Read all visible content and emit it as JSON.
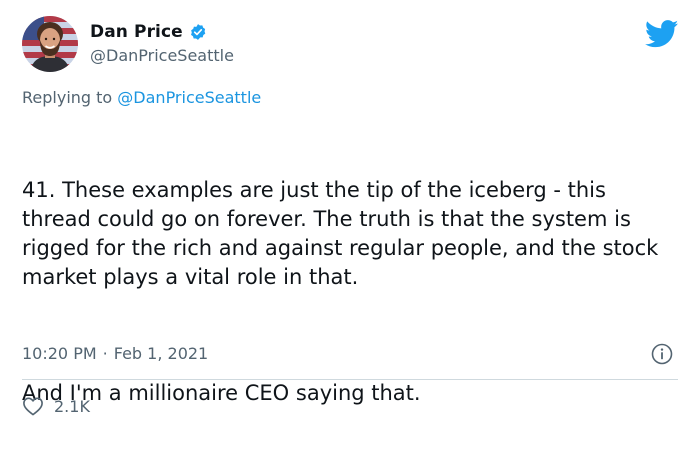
{
  "author": {
    "display_name": "Dan Price",
    "handle": "@DanPriceSeattle",
    "verified": true
  },
  "reply": {
    "prefix": "Replying to",
    "mention": "@DanPriceSeattle"
  },
  "tweet": {
    "paragraph_1": "41. These examples are just the tip of the iceberg - this thread could go on forever. The truth is that the system is rigged for the rich and against regular people, and the stock market plays a vital role in that.",
    "paragraph_2": "And I'm a millionaire CEO saying that."
  },
  "meta": {
    "time": "10:20 PM",
    "separator": "·",
    "date": "Feb 1, 2021"
  },
  "engagement": {
    "likes": "2.1K"
  },
  "icons": {
    "brand": "twitter-bird-icon",
    "verified": "verified-badge-icon",
    "info": "info-icon",
    "like": "heart-icon"
  },
  "colors": {
    "brand": "#1da1f2",
    "mention": "#1b95e0",
    "secondary_text": "#536471",
    "primary_text": "#0f1419",
    "divider": "#cfd9de"
  }
}
